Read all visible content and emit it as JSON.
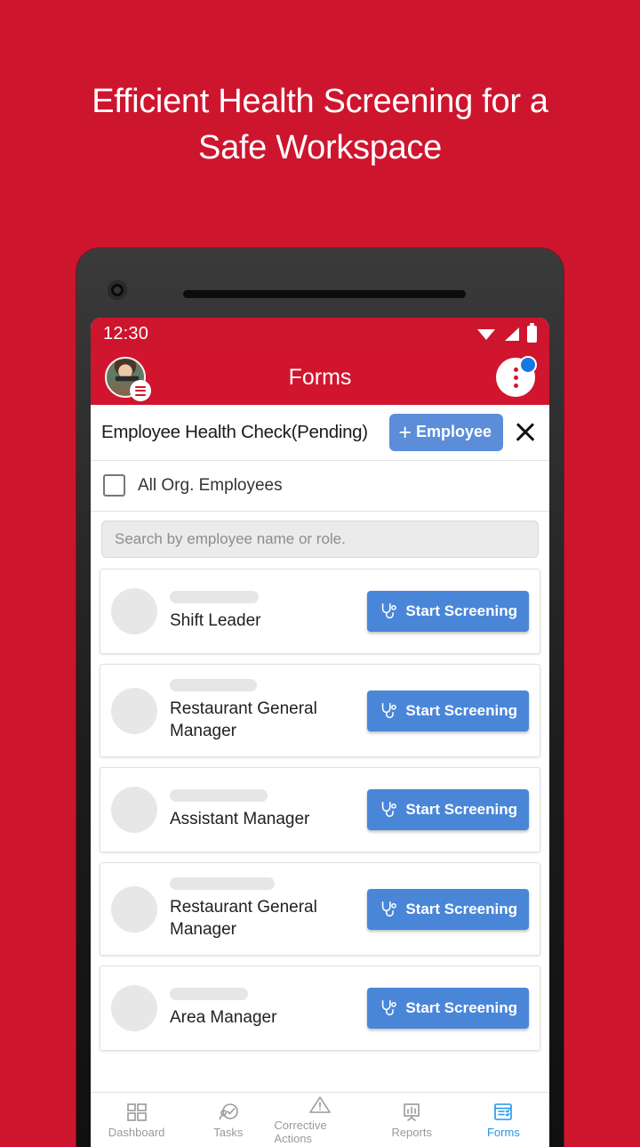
{
  "promo": {
    "headline": "Efficient Health Screening for a Safe Workspace",
    "background_color": "#CE152E"
  },
  "phone": {
    "status_bar": {
      "time": "12:30",
      "icons": [
        "wifi-icon",
        "signal-icon",
        "battery-icon"
      ],
      "background_color": "#CE152E"
    },
    "app_bar": {
      "title": "Forms",
      "avatar": "user-avatar",
      "avatar_badge": "hamburger-menu-icon",
      "overflow_menu": "more-vertical-icon",
      "notification_badge_color": "#1878E0"
    },
    "form_header": {
      "title": "Employee Health Check(Pending)",
      "add_button_label": "Employee",
      "add_button_plus": "+",
      "add_button_color": "#5B8DD9",
      "close_icon": "close-icon"
    },
    "filter": {
      "all_org_label": "All Org. Employees",
      "all_org_checked": false
    },
    "search": {
      "placeholder": "Search by employee name or role.",
      "value": ""
    },
    "employee_list": {
      "action_label": "Start Screening",
      "action_icon": "stethoscope-icon",
      "action_color": "#4A86D8",
      "items": [
        {
          "name": "",
          "role": "Shift Leader"
        },
        {
          "name": "",
          "role": "Restaurant General Manager"
        },
        {
          "name": "",
          "role": "Assistant Manager"
        },
        {
          "name": "",
          "role": "Restaurant General Manager"
        },
        {
          "name": "",
          "role": "Area Manager"
        }
      ]
    },
    "bottom_nav": {
      "active": "Forms",
      "active_color": "#2196E8",
      "items": [
        {
          "label": "Dashboard",
          "icon": "grid-icon"
        },
        {
          "label": "Tasks",
          "icon": "clock-check-icon"
        },
        {
          "label": "Corrective Actions",
          "icon": "warning-triangle-icon"
        },
        {
          "label": "Reports",
          "icon": "bar-chart-easel-icon"
        },
        {
          "label": "Forms",
          "icon": "form-checklist-icon"
        }
      ]
    }
  }
}
